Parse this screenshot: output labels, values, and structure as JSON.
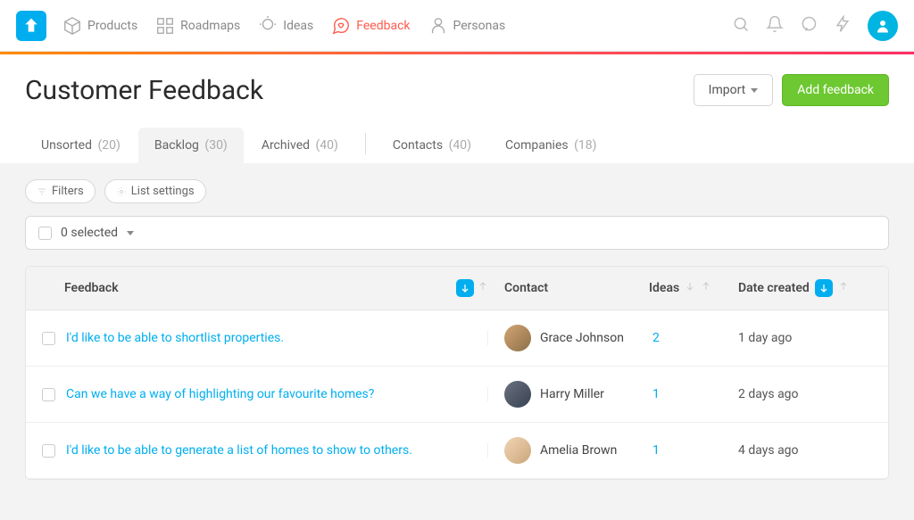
{
  "nav": {
    "items": [
      {
        "label": "Products"
      },
      {
        "label": "Roadmaps"
      },
      {
        "label": "Ideas"
      },
      {
        "label": "Feedback"
      },
      {
        "label": "Personas"
      }
    ]
  },
  "page": {
    "title": "Customer Feedback",
    "import_label": "Import",
    "add_feedback_label": "Add feedback"
  },
  "tabs": [
    {
      "label": "Unsorted",
      "count": "(20)"
    },
    {
      "label": "Backlog",
      "count": "(30)"
    },
    {
      "label": "Archived",
      "count": "(40)"
    },
    {
      "label": "Contacts",
      "count": "(40)"
    },
    {
      "label": "Companies",
      "count": "(18)"
    }
  ],
  "toolbar": {
    "filters_label": "Filters",
    "list_settings_label": "List settings",
    "selected_label": "0 selected"
  },
  "table": {
    "headers": {
      "feedback": "Feedback",
      "contact": "Contact",
      "ideas": "Ideas",
      "date": "Date created"
    },
    "rows": [
      {
        "feedback": "I'd like to be able to shortlist properties.",
        "contact": "Grace Johnson",
        "ideas": "2",
        "date": "1 day ago"
      },
      {
        "feedback": "Can we have a way of highlighting our favourite homes?",
        "contact": "Harry Miller",
        "ideas": "1",
        "date": "2 days ago"
      },
      {
        "feedback": "I'd like to be able to generate a list of homes to show to others.",
        "contact": "Amelia Brown",
        "ideas": "1",
        "date": "4 days ago"
      }
    ]
  }
}
